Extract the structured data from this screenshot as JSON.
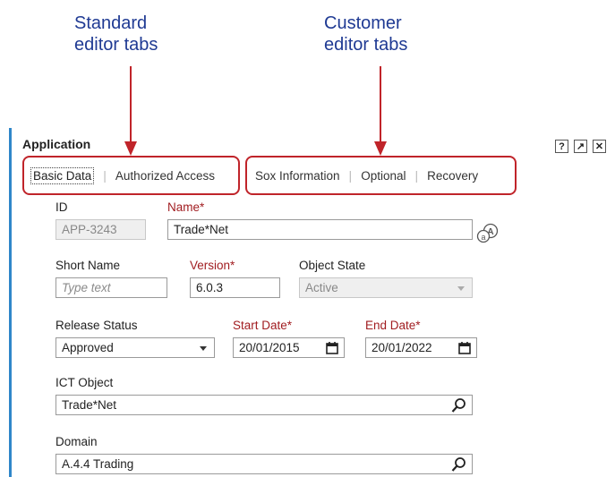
{
  "annotations": {
    "standard": "Standard editor tabs",
    "customer": "Customer editor tabs"
  },
  "colors": {
    "annotation_text": "#1f3a93",
    "highlight": "#c0242a",
    "required_label": "#a11d21",
    "accent_bar": "#2f86c9"
  },
  "window": {
    "title": "Application",
    "controls": [
      {
        "icon": "help-icon",
        "label": "?"
      },
      {
        "icon": "popout-icon",
        "label": "↗"
      },
      {
        "icon": "close-icon",
        "label": "✕"
      }
    ]
  },
  "tabs": {
    "standard": [
      {
        "label": "Basic Data",
        "active": true
      },
      {
        "label": "Authorized Access",
        "active": false
      }
    ],
    "customer": [
      {
        "label": "Sox Information",
        "active": false
      },
      {
        "label": "Optional",
        "active": false
      },
      {
        "label": "Recovery",
        "active": false
      }
    ]
  },
  "form": {
    "id": {
      "label": "ID",
      "value": "APP-3243"
    },
    "name": {
      "label": "Name*",
      "value": "Trade*Net",
      "icon": "translate-icon"
    },
    "short_name": {
      "label": "Short Name",
      "placeholder": "Type text"
    },
    "version": {
      "label": "Version*",
      "value": "6.0.3"
    },
    "object_state": {
      "label": "Object State",
      "value": "Active"
    },
    "release_status": {
      "label": "Release Status",
      "value": "Approved"
    },
    "start_date": {
      "label": "Start Date*",
      "value": "20/01/2015",
      "icon": "calendar-icon"
    },
    "end_date": {
      "label": "End Date*",
      "value": "20/01/2022",
      "icon": "calendar-icon"
    },
    "ict_object": {
      "label": "ICT Object",
      "value": "Trade*Net",
      "icon": "search-icon"
    },
    "domain": {
      "label": "Domain",
      "value": "A.4.4 Trading",
      "icon": "search-icon"
    }
  }
}
